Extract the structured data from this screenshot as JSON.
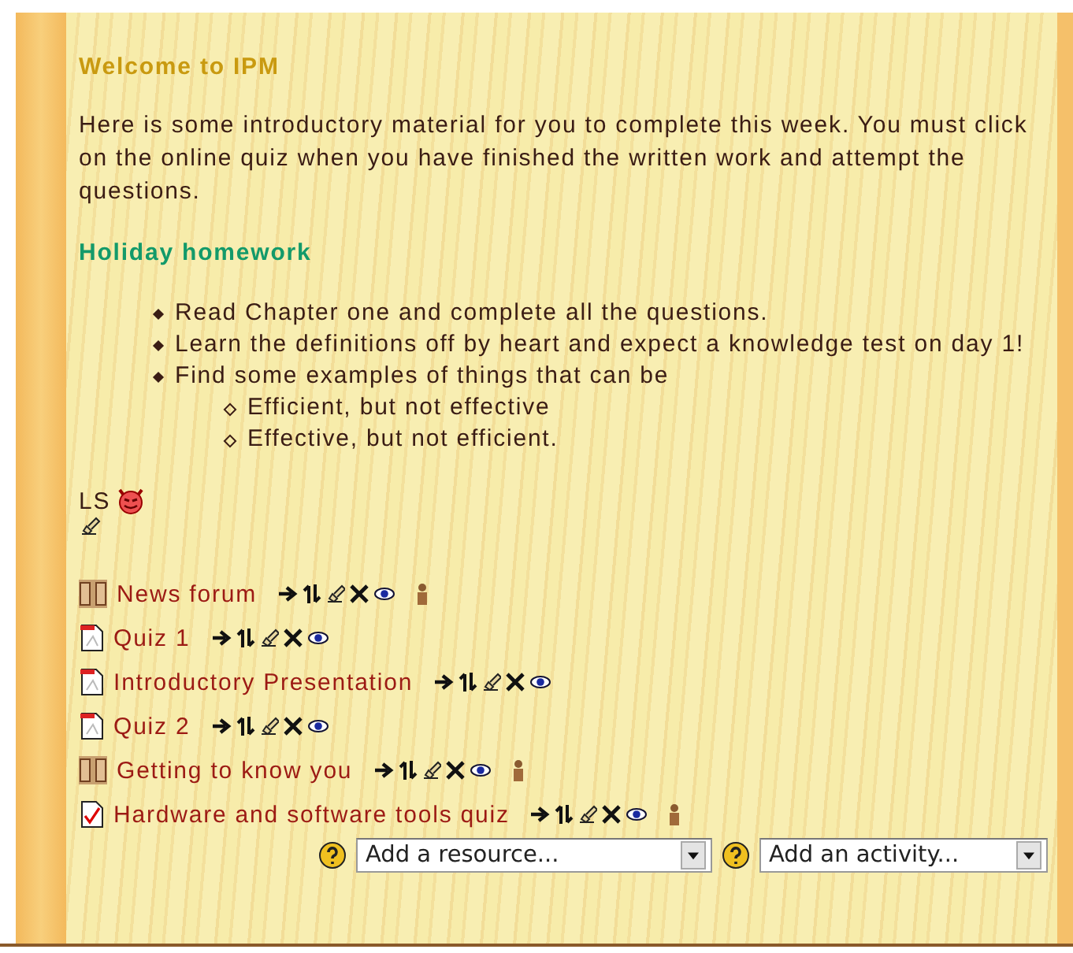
{
  "section": {
    "title": "Welcome to IPM",
    "intro": "Here is some introductory material for you to complete this week. You must click on the online quiz when you have finished the written work and attempt the questions.",
    "subtitle": "Holiday homework",
    "bullets": [
      {
        "text": "Read Chapter one and complete all the questions."
      },
      {
        "text": "Learn the definitions off by heart and expect a knowledge test on day 1!"
      },
      {
        "text": "Find some examples of things that can be",
        "children": [
          {
            "text": "Efficient, but not effective"
          },
          {
            "text": "Effective, but not efficient."
          }
        ]
      }
    ],
    "label": "LS",
    "activities": [
      {
        "kind": "forum",
        "name": "News forum",
        "groups": true
      },
      {
        "kind": "quiz",
        "name": "Quiz 1",
        "groups": false
      },
      {
        "kind": "resource",
        "name": "Introductory Presentation",
        "groups": false
      },
      {
        "kind": "quiz",
        "name": "Quiz 2",
        "groups": false
      },
      {
        "kind": "forum",
        "name": "Getting to know you",
        "groups": true
      },
      {
        "kind": "check",
        "name": "Hardware and software tools quiz",
        "groups": true
      }
    ],
    "add_resource": {
      "placeholder": "Add a resource..."
    },
    "add_activity": {
      "placeholder": "Add an activity..."
    }
  }
}
